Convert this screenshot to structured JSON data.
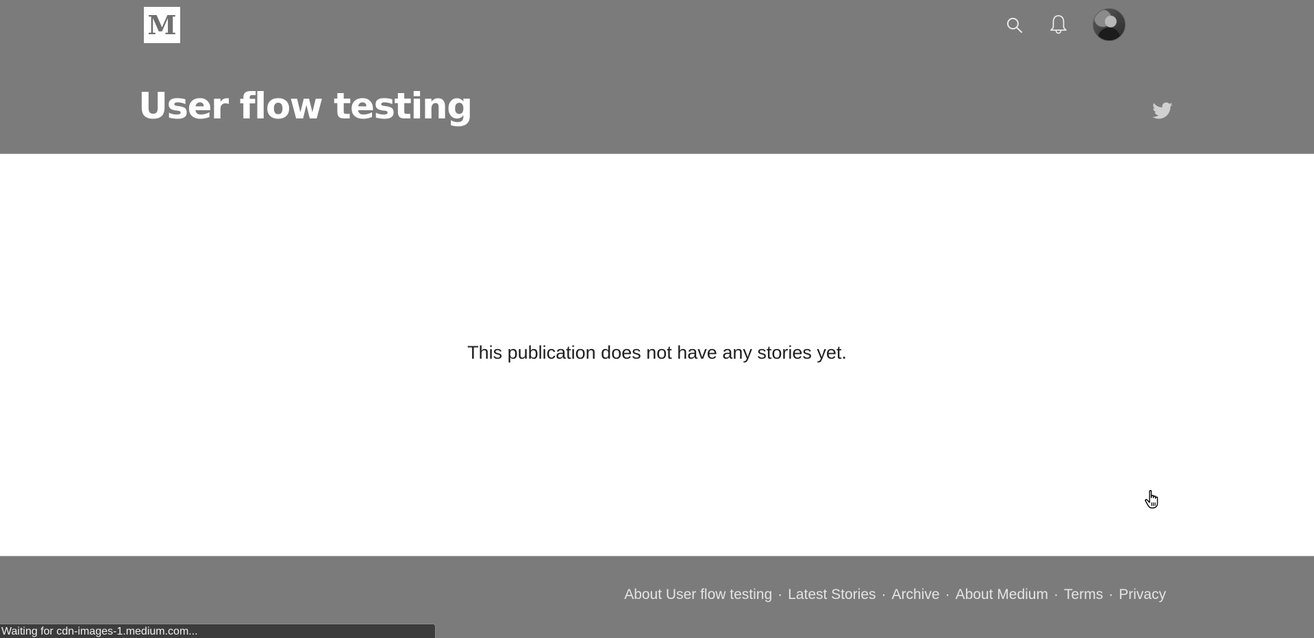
{
  "header": {
    "logo_letter": "M",
    "publication_title": "User flow testing",
    "icons": {
      "search": "search-icon",
      "notifications": "bell-icon",
      "avatar": "user-avatar",
      "social": "twitter-icon"
    }
  },
  "main": {
    "empty_message": "This publication does not have any stories yet."
  },
  "footer": {
    "links": [
      {
        "label": "About User flow testing"
      },
      {
        "label": "Latest Stories"
      },
      {
        "label": "Archive"
      },
      {
        "label": "About Medium"
      },
      {
        "label": "Terms"
      },
      {
        "label": "Privacy"
      }
    ],
    "separator": "·"
  },
  "status_bar": {
    "text": "Waiting for cdn-images-1.medium.com..."
  },
  "colors": {
    "header_bg": "#7b7b7b",
    "footer_bg": "#7b7b7b",
    "body_bg": "#ffffff",
    "title_text": "#ffffff",
    "footer_text": "#e4e4e4",
    "status_bg": "#3c3c3c"
  }
}
